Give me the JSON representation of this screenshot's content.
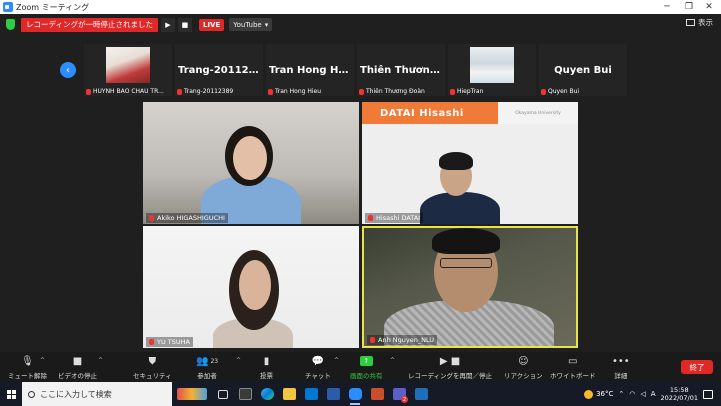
{
  "window": {
    "title": "Zoom ミーティング",
    "controls": [
      "─",
      "❐",
      "✕"
    ]
  },
  "recording": {
    "status": "レコーディングが一時停止されました",
    "resume_glyph": "▶",
    "stop_glyph": "■",
    "live_label": "LIVE",
    "stream_target": "YouTube",
    "stream_caret": "▾"
  },
  "view_button": {
    "label": "表示"
  },
  "strip_nav": {
    "glyph": "‹"
  },
  "strip": [
    {
      "display_name": "",
      "label": "HUỲNH BẢO CHÂU TR...",
      "has_photo": true
    },
    {
      "display_name": "Trang-20112389",
      "label": "Trang-20112389",
      "has_photo": false
    },
    {
      "display_name": "Tran Hong Hieu",
      "label": "Tran Hong Hieu",
      "has_photo": false
    },
    {
      "display_name": "Thiên  Thương...",
      "label": "Thiên Thương Đoàn",
      "has_photo": false
    },
    {
      "display_name": "",
      "label": "HiepTran",
      "has_photo": true
    },
    {
      "display_name": "Quyen Bui",
      "label": "Quyen Bui",
      "has_photo": false
    }
  ],
  "videos": {
    "akiko": {
      "label": "Akiko HIGASHIGUCHI"
    },
    "hisashi": {
      "label": "Hisashi DATAI",
      "slide_title": "DATAI   Hisashi",
      "slide_org": "Okayama University"
    },
    "yu": {
      "label": "YU TSUHA"
    },
    "anh": {
      "label": "Anh Nguyen_NLU"
    }
  },
  "toolbar": {
    "unmute": "ミュート解除",
    "stop_video": "ビデオの停止",
    "security": "セキュリティ",
    "participants": "参加者",
    "participants_count": "23",
    "polls": "投票",
    "chat": "チャット",
    "share": "画面の共有",
    "recording": "レコーディングを再開／停止",
    "reactions": "リアクション",
    "whiteboard": "ホワイトボード",
    "more": "詳細",
    "end": "終了",
    "caret": "^"
  },
  "taskbar": {
    "search_placeholder": "ここに入力して検索",
    "temperature": "36°C",
    "time": "15:58",
    "date": "2022/07/01",
    "badge": "2"
  },
  "colors": {
    "accent_blue": "#2d8cff",
    "rec_red": "#e02828",
    "share_green": "#2ecc40",
    "active_speaker": "#e6e44a",
    "slide_orange": "#f07a38"
  }
}
